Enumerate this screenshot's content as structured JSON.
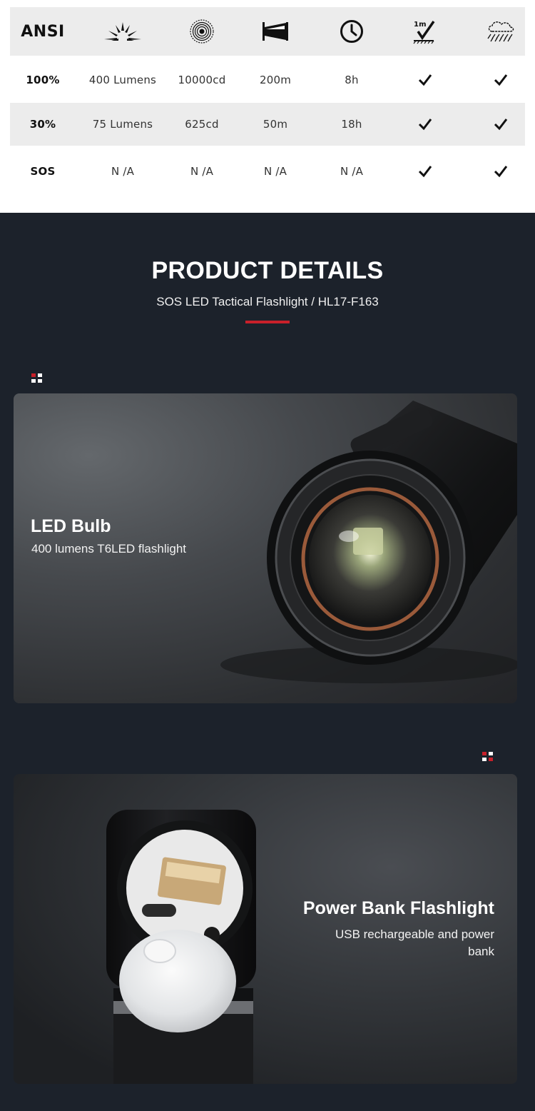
{
  "ansi_table": {
    "header": {
      "label": "ANSI",
      "icons": [
        "light-output-icon",
        "beam-intensity-icon",
        "beam-distance-icon",
        "runtime-clock-icon",
        "impact-resistance-icon",
        "water-resistance-icon"
      ],
      "impact_label": "1m"
    },
    "rows": [
      {
        "mode": "100%",
        "output": "400 Lumens",
        "intensity": "10000cd",
        "distance": "200m",
        "runtime": "8h",
        "impact": "✓",
        "water": "✓"
      },
      {
        "mode": "30%",
        "output": "75 Lumens",
        "intensity": "625cd",
        "distance": "50m",
        "runtime": "18h",
        "impact": "✓",
        "water": "✓"
      },
      {
        "mode": "SOS",
        "output": "N /A",
        "intensity": "N /A",
        "distance": "N /A",
        "runtime": "N /A",
        "impact": "✓",
        "water": "✓"
      }
    ]
  },
  "product_details": {
    "title": "PRODUCT DETAILS",
    "subtitle": "SOS LED Tactical Flashlight / HL17-F163"
  },
  "features": [
    {
      "title": "LED Bulb",
      "description": "400 lumens T6LED flashlight"
    },
    {
      "title": "Power Bank Flashlight",
      "description": "USB rechargeable and power bank"
    }
  ],
  "colors": {
    "accent_red": "#c8202a",
    "page_dark": "#1c222b",
    "table_stripe": "#ececec"
  }
}
